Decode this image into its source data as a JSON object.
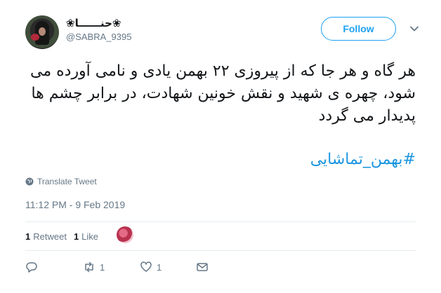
{
  "user": {
    "display_name": "❀حنــــــا❀",
    "username": "@SABRA_9395"
  },
  "follow_label": "Follow",
  "tweet": {
    "text": "هر گاه و هر جا که از پیروزی ۲۲ بهمن یادی و نامی آورده می شود، چهره ی شهید و نقش خونین شهادت، در برابر چشم ها پدیدار می گردد",
    "hashtag": "#بهمن_تماشایی"
  },
  "translate_label": "Translate Tweet",
  "timestamp": "11:12 PM - 9 Feb 2019",
  "stats": {
    "retweets_count": "1",
    "retweets_label": "Retweet",
    "likes_count": "1",
    "likes_label": "Like"
  },
  "actions": {
    "retweet_count": "1",
    "like_count": "1"
  },
  "colors": {
    "accent": "#1da1f2",
    "hashtag": "#1b95e0",
    "muted": "#657786"
  },
  "icons": [
    "avatar",
    "chevron-down-icon",
    "globe-icon",
    "reply-icon",
    "retweet-icon",
    "heart-icon",
    "message-icon"
  ]
}
